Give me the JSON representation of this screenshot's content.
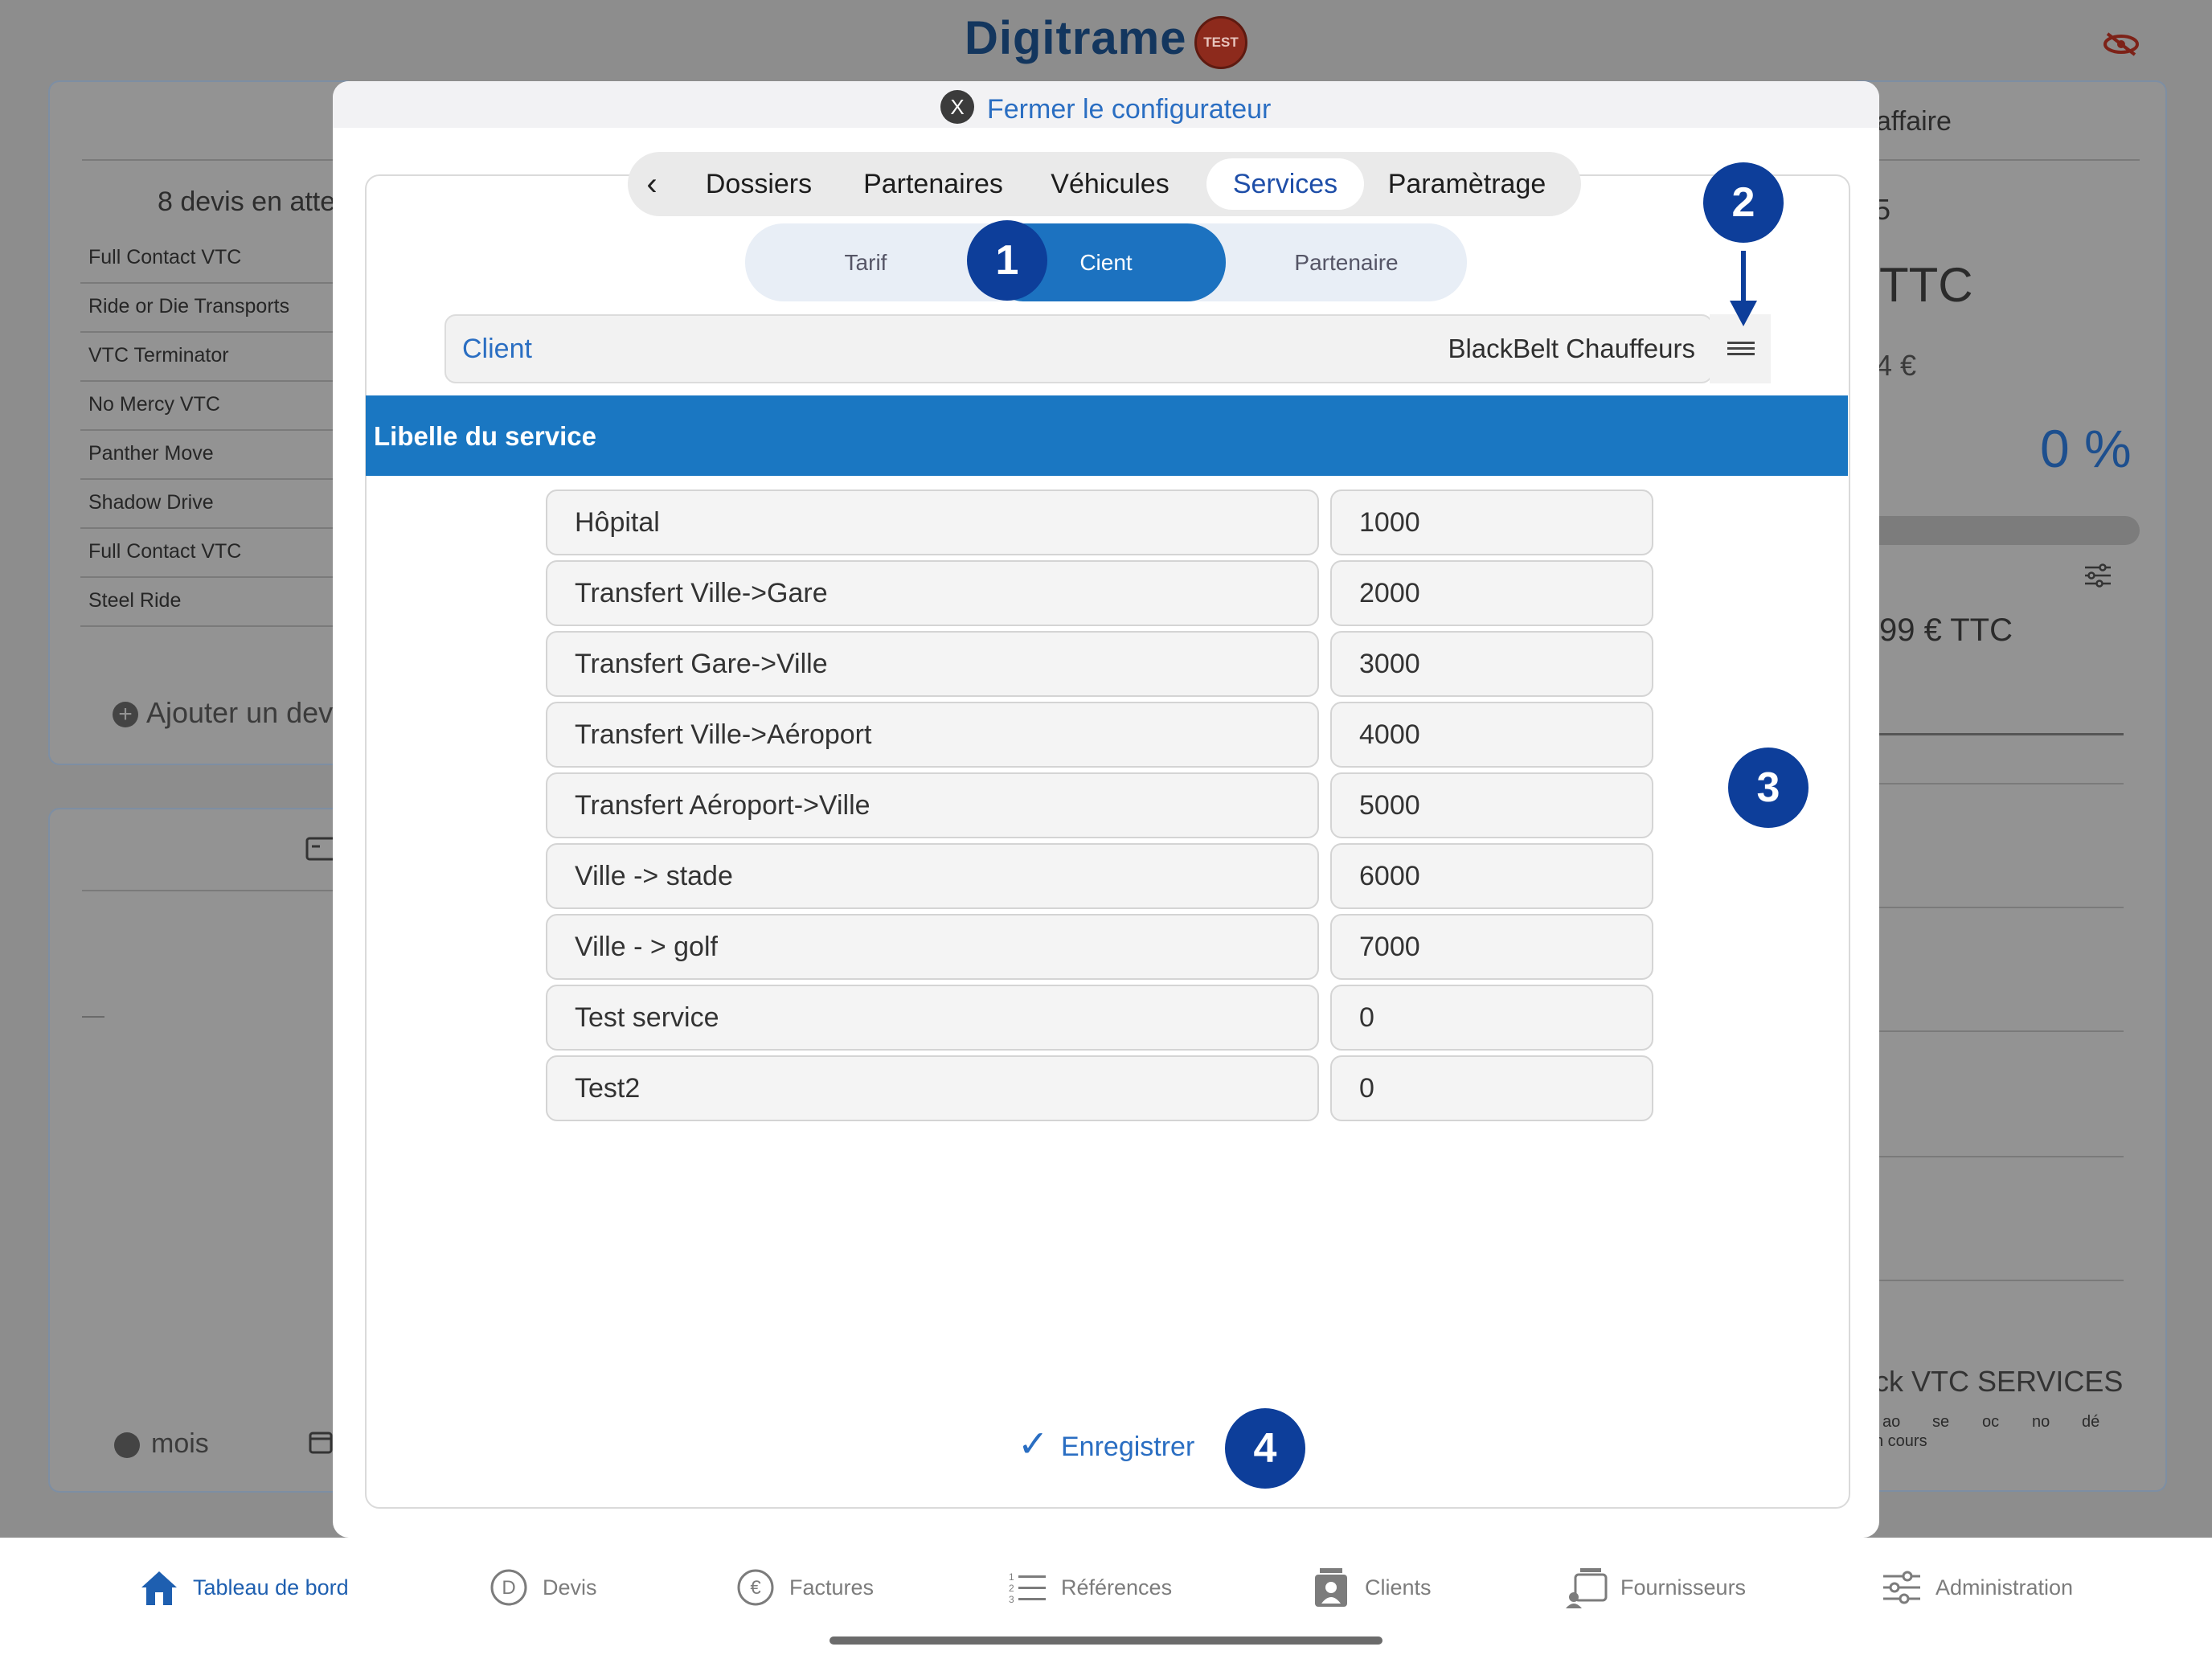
{
  "app": {
    "logo": "Digitrame",
    "badge": "TEST"
  },
  "background": {
    "quotes_heading": "8 devis en atte",
    "quotes": [
      "Full Contact VTC",
      "Ride or Die Transports",
      "VTC Terminator",
      "No Mercy VTC",
      "Panther Move",
      "Shadow Drive",
      "Full Contact VTC",
      "Steel Ride"
    ],
    "add_quote": "Ajouter un dev",
    "month_label": "mois",
    "right_title": "affaire",
    "right_digit": "5",
    "right_ttc": "TTC",
    "right_amount": "4 €",
    "right_percent": "0 %",
    "right_amount2": "99 € TTC",
    "right_company": "ck VTC SERVICES",
    "right_months": [
      "ao",
      "se",
      "oc",
      "no",
      "dé"
    ],
    "right_status": "n cours",
    "dash": "—"
  },
  "modal": {
    "close_icon": "X",
    "close_label": "Fermer le configurateur",
    "tabs": [
      "Dossiers",
      "Partenaires",
      "Véhicules",
      "Services",
      "Paramètrage"
    ],
    "active_tab": "Services",
    "segments": [
      "Tarif",
      "Cient",
      "Partenaire"
    ],
    "active_segment": "Cient",
    "client_label": "Client",
    "client_value": "BlackBelt Chauffeurs",
    "services_header": "Libelle du service",
    "services": [
      {
        "name": "Hôpital",
        "value": "1000"
      },
      {
        "name": "Transfert Ville->Gare",
        "value": "2000"
      },
      {
        "name": "Transfert Gare->Ville",
        "value": "3000"
      },
      {
        "name": "Transfert Ville->Aéroport",
        "value": "4000"
      },
      {
        "name": "Transfert Aéroport->Ville",
        "value": "5000"
      },
      {
        "name": "Ville -> stade",
        "value": "6000"
      },
      {
        "name": "Ville - > golf",
        "value": "7000"
      },
      {
        "name": "Test service",
        "value": "0"
      },
      {
        "name": "Test2",
        "value": "0"
      }
    ],
    "save_label": "Enregistrer"
  },
  "steps": [
    "1",
    "2",
    "3",
    "4"
  ],
  "tabbar": [
    {
      "label": "Tableau de bord",
      "icon": "home-icon"
    },
    {
      "label": "Devis",
      "icon": "d-circle-icon"
    },
    {
      "label": "Factures",
      "icon": "euro-icon"
    },
    {
      "label": "Références",
      "icon": "list-icon"
    },
    {
      "label": "Clients",
      "icon": "clients-icon"
    },
    {
      "label": "Fournisseurs",
      "icon": "suppliers-icon"
    },
    {
      "label": "Administration",
      "icon": "sliders-icon"
    }
  ],
  "colors": {
    "accent": "#1a77c2",
    "step": "#0d3e9a",
    "link": "#2a6ec2"
  }
}
